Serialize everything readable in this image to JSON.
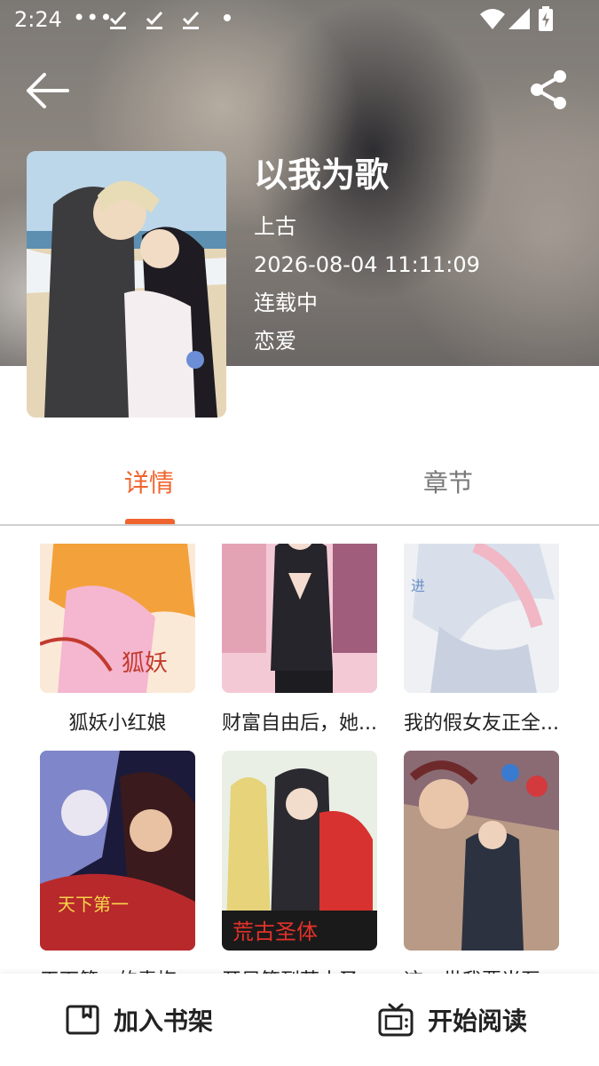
{
  "status_bar": {
    "time": "2:24",
    "notification_dots": "•••"
  },
  "toolbar": {
    "back_icon": "arrow-left-icon",
    "share_icon": "share-icon"
  },
  "book": {
    "title": "以我为歌",
    "author": "上古",
    "updated": "2026-08-04 11:11:09",
    "status": "连载中",
    "genre": "恋爱"
  },
  "tabs": [
    {
      "label": "详情",
      "active": true
    },
    {
      "label": "章节",
      "active": false
    }
  ],
  "recommendations": [
    {
      "title": "狐妖小红娘"
    },
    {
      "title": "财富自由后，她..."
    },
    {
      "title": "我的假女友正全..."
    },
    {
      "title": "天下第一的青梅..."
    },
    {
      "title": "开局签到荒古圣..."
    },
    {
      "title": "这一世我要当至..."
    }
  ],
  "bottom_bar": {
    "add_shelf": "加入书架",
    "start_reading": "开始阅读"
  },
  "colors": {
    "accent": "#f0642d",
    "tab_inactive": "#777777"
  }
}
